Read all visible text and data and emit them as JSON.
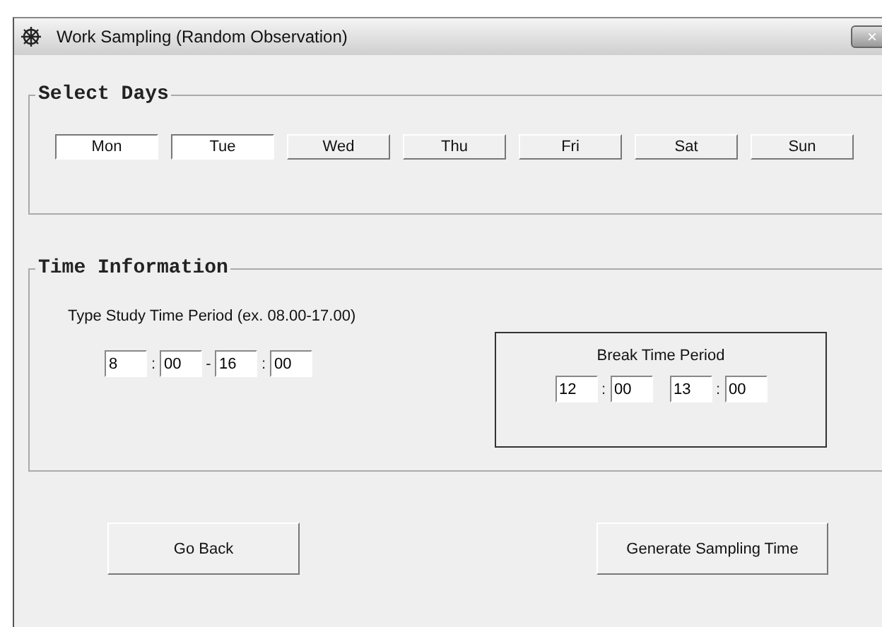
{
  "window": {
    "title": "Work Sampling (Random Observation)",
    "close": "×"
  },
  "select_days": {
    "title": "Select Days",
    "days": [
      {
        "label": "Mon",
        "selected": true
      },
      {
        "label": "Tue",
        "selected": true
      },
      {
        "label": "Wed",
        "selected": false
      },
      {
        "label": "Thu",
        "selected": false
      },
      {
        "label": "Fri",
        "selected": false
      },
      {
        "label": "Sat",
        "selected": false
      },
      {
        "label": "Sun",
        "selected": false
      }
    ]
  },
  "time_information": {
    "title": "Time Information",
    "study": {
      "label": "Type Study Time Period (ex. 08.00-17.00)",
      "start_hour": "8",
      "start_separator": ":",
      "start_minute": "00",
      "range_separator": "-",
      "end_hour": "16",
      "end_separator": ":",
      "end_minute": "00"
    },
    "break": {
      "label": "Break Time Period",
      "start_hour": "12",
      "start_separator": ":",
      "start_minute": "00",
      "end_hour": "13",
      "end_separator": ":",
      "end_minute": "00"
    }
  },
  "buttons": [
    "Go Back",
    "Generate Sampling Time"
  ]
}
